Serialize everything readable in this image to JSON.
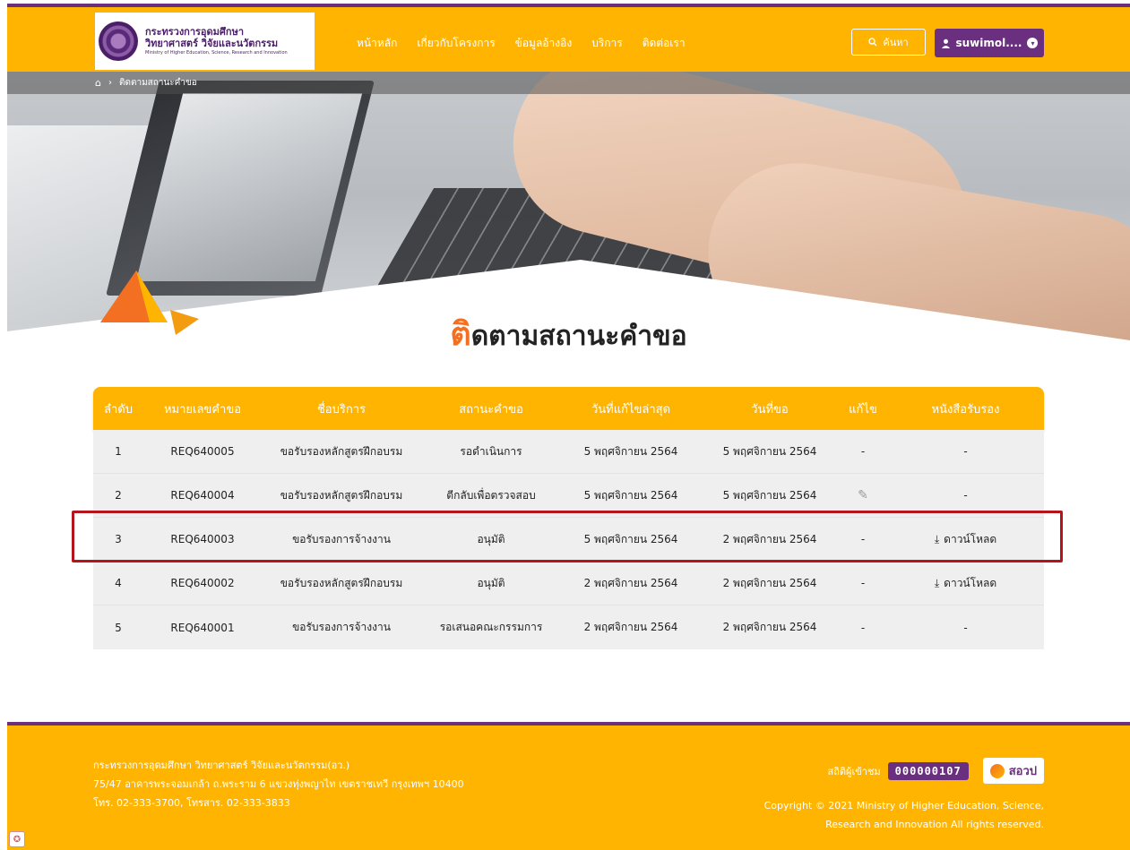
{
  "header": {
    "logo": {
      "line1": "กระทรวงการอุดมศึกษา",
      "line2": "วิทยาศาสตร์ วิจัยและนวัตกรรม",
      "line3": "Ministry of Higher Education, Science, Research and Innovation"
    },
    "nav": [
      {
        "label": "หน้าหลัก"
      },
      {
        "label": "เกี่ยวกับโครงการ"
      },
      {
        "label": "ข้อมูลอ้างอิง"
      },
      {
        "label": "บริการ"
      },
      {
        "label": "ติดต่อเรา"
      }
    ],
    "search_label": "ค้นหา",
    "user_label": "suwimol....",
    "colors": {
      "accent": "#ffb401",
      "brand": "#6b2f7f",
      "title_accent": "#f36f21",
      "highlight": "#b5141d"
    }
  },
  "breadcrumb": {
    "home_icon": "home-icon",
    "current": "ติดตามสถานะคำขอ"
  },
  "page": {
    "title_first": "ติ",
    "title_rest": "ดตามสถานะคำขอ"
  },
  "table": {
    "headers": [
      "ลำดับ",
      "หมายเลขคำขอ",
      "ชื่อบริการ",
      "สถานะคำขอ",
      "วันที่แก้ไขล่าสุด",
      "วันที่ขอ",
      "แก้ไข",
      "หนังสือรับรอง"
    ],
    "rows": [
      {
        "no": "1",
        "req": "REQ640005",
        "service": "ขอรับรองหลักสูตรฝึกอบรม",
        "status": "รอดำเนินการ",
        "updated": "5 พฤศจิกายน 2564",
        "requested": "5 พฤศจิกายน 2564",
        "edit": "-",
        "cert": "-"
      },
      {
        "no": "2",
        "req": "REQ640004",
        "service": "ขอรับรองหลักสูตรฝึกอบรม",
        "status": "ตีกลับเพื่อตรวจสอบ",
        "updated": "5 พฤศจิกายน 2564",
        "requested": "5 พฤศจิกายน 2564",
        "edit": "✎",
        "cert": "-"
      },
      {
        "no": "3",
        "req": "REQ640003",
        "service": "ขอรับรองการจ้างงาน",
        "status": "อนุมัติ",
        "updated": "5 พฤศจิกายน 2564",
        "requested": "2 พฤศจิกายน 2564",
        "edit": "-",
        "cert": "ดาวน์โหลด"
      },
      {
        "no": "4",
        "req": "REQ640002",
        "service": "ขอรับรองหลักสูตรฝึกอบรม",
        "status": "อนุมัติ",
        "updated": "2 พฤศจิกายน 2564",
        "requested": "2 พฤศจิกายน 2564",
        "edit": "-",
        "cert": "ดาวน์โหลด"
      },
      {
        "no": "5",
        "req": "REQ640001",
        "service": "ขอรับรองการจ้างงาน",
        "status": "รอเสนอคณะกรรมการ",
        "updated": "2 พฤศจิกายน 2564",
        "requested": "2 พฤศจิกายน 2564",
        "edit": "-",
        "cert": "-"
      }
    ]
  },
  "footer": {
    "org": "กระทรวงการอุดมศึกษา วิทยาศาสตร์ วิจัยและนวัตกรรม(อว.)",
    "address": "75/47 อาคารพระจอมเกล้า ถ.พระราม 6 แขวงทุ่งพญาไท เขตราชเทวี กรุงเทพฯ 10400",
    "phone": "โทร. 02-333-3700, โทรสาร. 02-333-3833",
    "stat_label": "สถิติผู้เข้าชม",
    "counter": "000000107",
    "brand": "สอวป",
    "copyright1": "Copyright © 2021 Ministry of Higher Education, Science,",
    "copyright2": "Research and Innovation All rights reserved."
  }
}
